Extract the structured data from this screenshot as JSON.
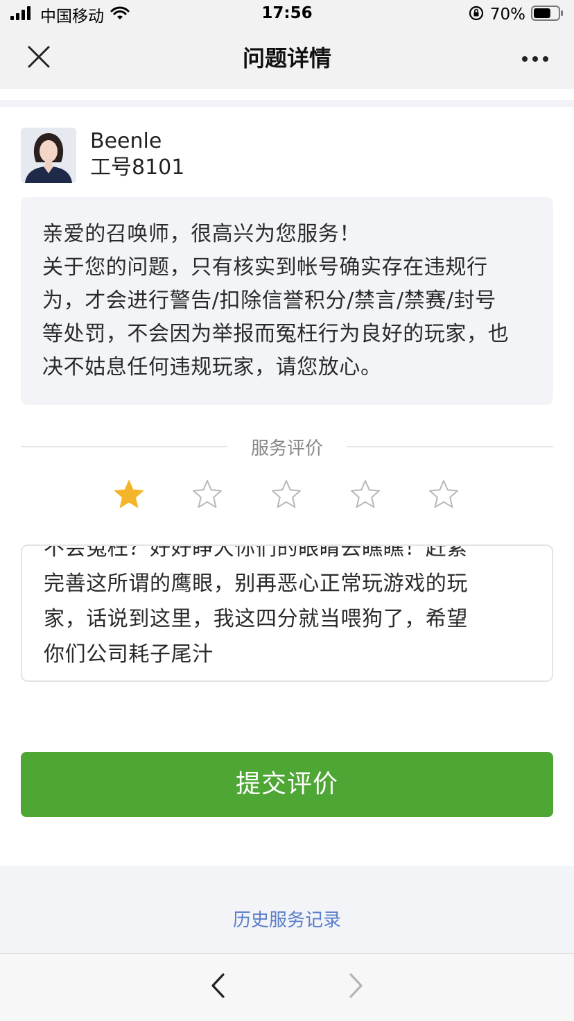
{
  "status_bar": {
    "carrier": "中国移动",
    "time": "17:56",
    "battery_percent": "70%",
    "battery_level": 0.7,
    "icons": [
      "signal-icon",
      "wifi-icon",
      "orientation-lock-icon",
      "battery-icon"
    ]
  },
  "nav": {
    "title": "问题详情",
    "close_icon": "close-icon",
    "more_icon": "more-icon"
  },
  "agent": {
    "name": "Beenle",
    "id_label": "工号8101"
  },
  "reply": {
    "lines": [
      "亲爱的召唤师，很高兴为您服务！",
      "关于您的问题，只有核实到帐号确实存在违规行",
      "为，才会进行警告/扣除信誉积分/禁言/禁赛/封号",
      "等处罚，不会因为举报而冤枉行为良好的玩家，也",
      "决不姑息任何违规玩家，请您放心。"
    ]
  },
  "rating": {
    "label": "服务评价",
    "value": 1,
    "max": 5,
    "filled_color": "#f5b52a",
    "empty_color": "#b8b8b8"
  },
  "comment": {
    "lines": [
      "不会冤枉？好好睁大你们的眼睛去瞧瞧！赶紧",
      "完善这所谓的鹰眼，别再恶心正常玩游戏的玩",
      "家，话说到这里，我这四分就当喂狗了，希望",
      "你们公司耗子尾汁"
    ]
  },
  "submit": {
    "label": "提交评价",
    "color": "#4ea735"
  },
  "history": {
    "link": "历史服务记录",
    "color": "#5a7ec8"
  },
  "toolbar": {
    "back_icon": "back-arrow-icon",
    "forward_icon": "forward-arrow-icon"
  }
}
